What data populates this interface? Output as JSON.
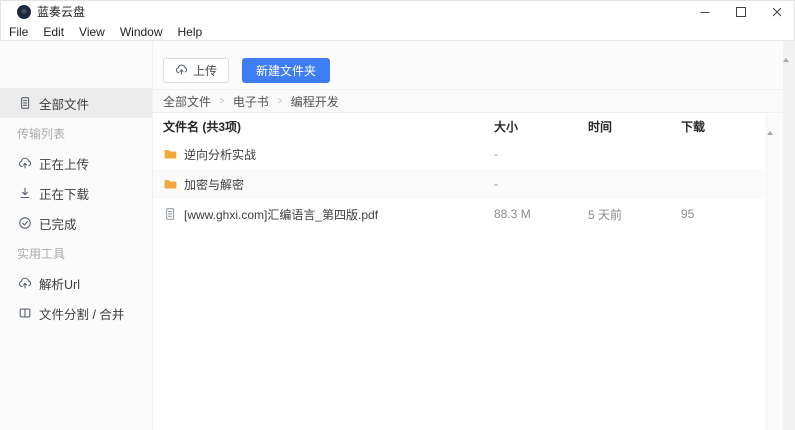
{
  "window": {
    "title": "蓝奏云盘"
  },
  "menu": {
    "items": [
      "File",
      "Edit",
      "View",
      "Window",
      "Help"
    ]
  },
  "sidebar": {
    "items": [
      {
        "type": "item",
        "id": "all-files",
        "label": "全部文件",
        "icon": "files-icon",
        "selected": true
      },
      {
        "type": "section",
        "label": "传输列表"
      },
      {
        "type": "item",
        "id": "uploading",
        "label": "正在上传",
        "icon": "upload-cloud-icon"
      },
      {
        "type": "item",
        "id": "downloading",
        "label": "正在下载",
        "icon": "download-icon"
      },
      {
        "type": "item",
        "id": "completed",
        "label": "已完成",
        "icon": "check-circle-icon"
      },
      {
        "type": "section",
        "label": "实用工具"
      },
      {
        "type": "item",
        "id": "parse-url",
        "label": "解析Url",
        "icon": "cloud-up-icon"
      },
      {
        "type": "item",
        "id": "split-merge",
        "label": "文件分割 / 合并",
        "icon": "split-icon"
      }
    ]
  },
  "toolbar": {
    "upload_label": "上传",
    "new_folder_label": "新建文件夹"
  },
  "breadcrumb": {
    "items": [
      "全部文件",
      "电子书",
      "编程开发"
    ],
    "separator": ">"
  },
  "table": {
    "headers": {
      "name": "文件名 (共3项)",
      "size": "大小",
      "time": "时间",
      "downloads": "下载"
    },
    "rows": [
      {
        "type": "folder",
        "name": "逆向分析实战",
        "size": "-",
        "time": "",
        "downloads": ""
      },
      {
        "type": "folder",
        "name": "加密与解密",
        "size": "-",
        "time": "",
        "downloads": ""
      },
      {
        "type": "file",
        "name": "[www.ghxi.com]汇编语言_第四版.pdf",
        "size": "88.3 M",
        "time": "5 天前",
        "downloads": "95"
      }
    ]
  },
  "colors": {
    "accent_blue": "#3e7ef2",
    "folder_orange": "#f2a83c",
    "selected_bg": "#ececec"
  }
}
